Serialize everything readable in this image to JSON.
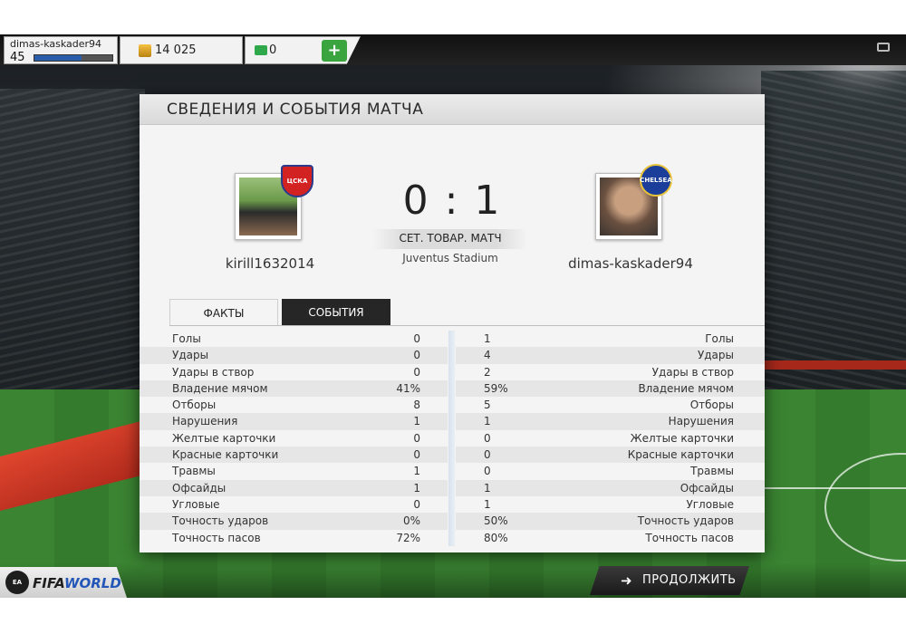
{
  "hud": {
    "username": "dimas-kaskader94",
    "level": "45",
    "xp_progress": 0.6,
    "coins": "14 025",
    "points": "0",
    "add_label": "+"
  },
  "panel": {
    "title": "СВЕДЕНИЯ И СОБЫТИЯ МАТЧА",
    "score": "0 : 1",
    "match_type": "СЕТ. ТОВАР. МАТЧ",
    "stadium": "Juventus Stadium",
    "home_player": "kirill1632014",
    "away_player": "dimas-kaskader94",
    "home_badge": "ЦСКА",
    "away_badge": "CHELSEA",
    "tabs": [
      "ФАКТЫ",
      "СОБЫТИЯ"
    ]
  },
  "stats": [
    {
      "label": "Голы",
      "home": "0",
      "away": "1"
    },
    {
      "label": "Удары",
      "home": "0",
      "away": "4"
    },
    {
      "label": "Удары в створ",
      "home": "0",
      "away": "2"
    },
    {
      "label": "Владение мячом",
      "home": "41%",
      "away": "59%"
    },
    {
      "label": "Отборы",
      "home": "8",
      "away": "5"
    },
    {
      "label": "Нарушения",
      "home": "1",
      "away": "1"
    },
    {
      "label": "Желтые карточки",
      "home": "0",
      "away": "0"
    },
    {
      "label": "Красные карточки",
      "home": "0",
      "away": "0"
    },
    {
      "label": "Травмы",
      "home": "1",
      "away": "0"
    },
    {
      "label": "Офсайды",
      "home": "1",
      "away": "1"
    },
    {
      "label": "Угловые",
      "home": "0",
      "away": "1"
    },
    {
      "label": "Точность ударов",
      "home": "0%",
      "away": "50%"
    },
    {
      "label": "Точность пасов",
      "home": "72%",
      "away": "80%"
    }
  ],
  "footer": {
    "continue_label": "ПРОДОЛЖИТЬ",
    "logo_fifa": "FIFA",
    "logo_world": "WORLD",
    "ea_label": "EA SPORTS"
  },
  "colors": {
    "accent": "#2a5ea8",
    "plus_button": "#3aa53f",
    "panel_bg": "#f4f4f4",
    "events_tab": "#262626"
  }
}
